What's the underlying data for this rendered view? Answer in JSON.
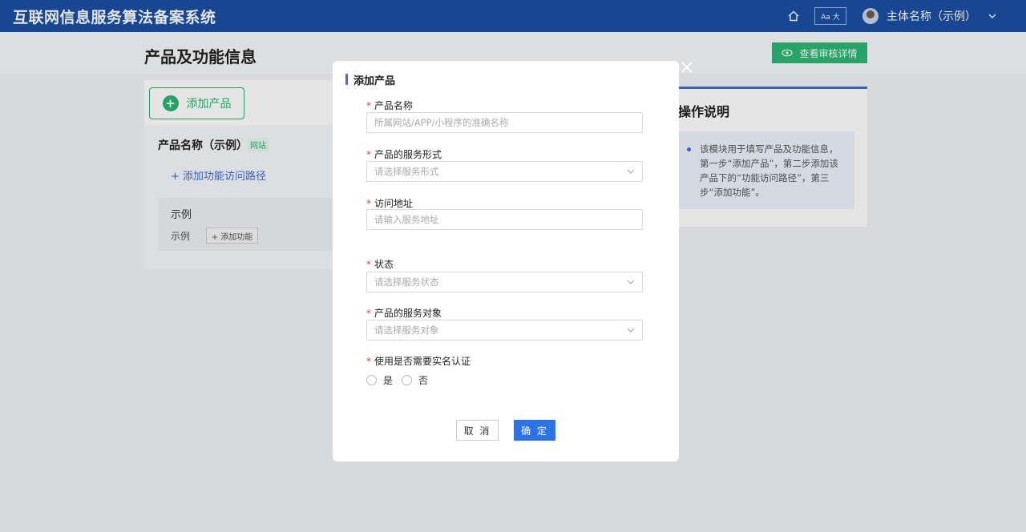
{
  "header": {
    "app_title": "互联网信息服务算法备案系统",
    "font_size_label": "Aa 大",
    "user_name": "主体名称（示例）"
  },
  "page": {
    "title": "产品及功能信息",
    "audit_button": "查看审核详情",
    "add_product_button": "添加产品"
  },
  "product": {
    "name": "产品名称（示例）",
    "type_tag": "网站",
    "add_path_link": "+ 添加功能访问路径",
    "example_title": "示例",
    "example_row_label": "示例",
    "add_function_button": "+ 添加功能"
  },
  "instructions": {
    "title": "操作说明",
    "text": "该模块用于填写产品及功能信息，第一步“添加产品”，第二步添加该产品下的“功能访问路径”，第三步“添加功能”。"
  },
  "modal": {
    "title": "添加产品",
    "required_mark": "*",
    "fields": {
      "product_name": {
        "label": "产品名称",
        "placeholder": "所属网站/APP/小程序的准确名称"
      },
      "service_form": {
        "label": "产品的服务形式",
        "placeholder": "请选择服务形式"
      },
      "access_url": {
        "label": "访问地址",
        "placeholder": "请输入服务地址"
      },
      "status": {
        "label": "状态",
        "placeholder": "请选择服务状态"
      },
      "service_target": {
        "label": "产品的服务对象",
        "placeholder": "请选择服务对象"
      },
      "real_name": {
        "label": "使用是否需要实名认证",
        "options": [
          "是",
          "否"
        ]
      }
    },
    "cancel_label": "取 消",
    "ok_label": "确 定"
  },
  "colors": {
    "header_bg": "#1a4fa3",
    "accent_green": "#2bb673",
    "primary_blue": "#2a73e8"
  }
}
